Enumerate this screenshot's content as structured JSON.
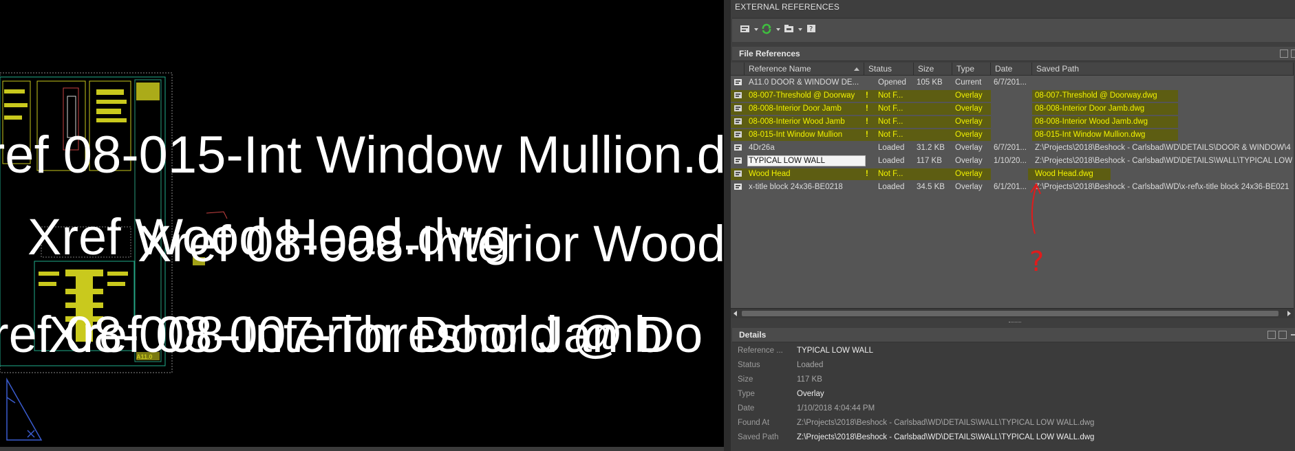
{
  "canvas": {
    "overlay_texts": [
      "ref 08-015-Int Window Mullion.d",
      "Xref Wood Head.dwg",
      "Xref 08-008-Interior Wood",
      "ref 08-008-Interior Door Jamb",
      "Xref 08-007-Threshold @ Do"
    ],
    "sheet_number": "A11.0"
  },
  "palette": {
    "title": "EXTERNAL REFERENCES",
    "file_references_label": "File References",
    "details_label": "Details",
    "columns": [
      "Reference Name",
      "Status",
      "Size",
      "Type",
      "Date",
      "Saved Path"
    ],
    "rows": [
      {
        "name": "A11.0 DOOR & WINDOW DE...",
        "status": "Opened",
        "size": "105 KB",
        "type": "Current",
        "date": "6/7/201...",
        "path": "",
        "warn": "",
        "highlight": false,
        "selected": false
      },
      {
        "name": "08-007-Threshold @ Doorway",
        "status": "Not F...",
        "size": "",
        "type": "Overlay",
        "date": "",
        "path": "08-007-Threshold @ Doorway.dwg",
        "warn": "!",
        "highlight": true,
        "selected": false
      },
      {
        "name": "08-008-Interior Door Jamb",
        "status": "Not F...",
        "size": "",
        "type": "Overlay",
        "date": "",
        "path": "08-008-Interior Door Jamb.dwg",
        "warn": "!",
        "highlight": true,
        "selected": false
      },
      {
        "name": "08-008-Interior Wood Jamb",
        "status": "Not F...",
        "size": "",
        "type": "Overlay",
        "date": "",
        "path": "08-008-Interior Wood Jamb.dwg",
        "warn": "!",
        "highlight": true,
        "selected": false
      },
      {
        "name": "08-015-Int Window Mullion",
        "status": "Not F...",
        "size": "",
        "type": "Overlay",
        "date": "",
        "path": "08-015-Int Window Mullion.dwg",
        "warn": "!",
        "highlight": true,
        "selected": false
      },
      {
        "name": "4Dr26a",
        "status": "Loaded",
        "size": "31.2 KB",
        "type": "Overlay",
        "date": "6/7/201...",
        "path": "Z:\\Projects\\2018\\Beshock - Carlsbad\\WD\\DETAILS\\DOOR & WINDOW\\4",
        "warn": "",
        "highlight": false,
        "selected": false
      },
      {
        "name": "TYPICAL LOW WALL",
        "status": "Loaded",
        "size": "117 KB",
        "type": "Overlay",
        "date": "1/10/20...",
        "path": "Z:\\Projects\\2018\\Beshock - Carlsbad\\WD\\DETAILS\\WALL\\TYPICAL LOW",
        "warn": "",
        "highlight": false,
        "selected": true
      },
      {
        "name": "Wood Head",
        "status": "Not F...",
        "size": "",
        "type": "Overlay",
        "date": "",
        "path": "Wood Head.dwg",
        "warn": "!",
        "highlight": true,
        "selected": false
      },
      {
        "name": "x-title block 24x36-BE0218",
        "status": "Loaded",
        "size": "34.5 KB",
        "type": "Overlay",
        "date": "6/1/201...",
        "path": "Z:\\Projects\\2018\\Beshock - Carlsbad\\WD\\x-ref\\x-title block 24x36-BE021",
        "warn": "",
        "highlight": false,
        "selected": false
      }
    ],
    "details": [
      {
        "label": "Reference ...",
        "value": "TYPICAL LOW WALL",
        "dim": false
      },
      {
        "label": "Status",
        "value": "Loaded",
        "dim": true
      },
      {
        "label": "Size",
        "value": "117 KB",
        "dim": true
      },
      {
        "label": "Type",
        "value": "Overlay",
        "dim": false
      },
      {
        "label": "Date",
        "value": "1/10/2018 4:04:44 PM",
        "dim": true
      },
      {
        "label": "Found At",
        "value": "Z:\\Projects\\2018\\Beshock - Carlsbad\\WD\\DETAILS\\WALL\\TYPICAL LOW WALL.dwg",
        "dim": true
      },
      {
        "label": "Saved Path",
        "value": "Z:\\Projects\\2018\\Beshock - Carlsbad\\WD\\DETAILS\\WALL\\TYPICAL LOW WALL.dwg",
        "dim": false
      }
    ],
    "annotation_text": "?",
    "colors": {
      "highlight_text": "#f2f200",
      "annotation": "#e01b1b",
      "background": "#3e3e3e"
    },
    "toolbar_icons": [
      "attach-dwg-icon",
      "refresh-icon",
      "change-path-icon",
      "help-icon"
    ]
  }
}
